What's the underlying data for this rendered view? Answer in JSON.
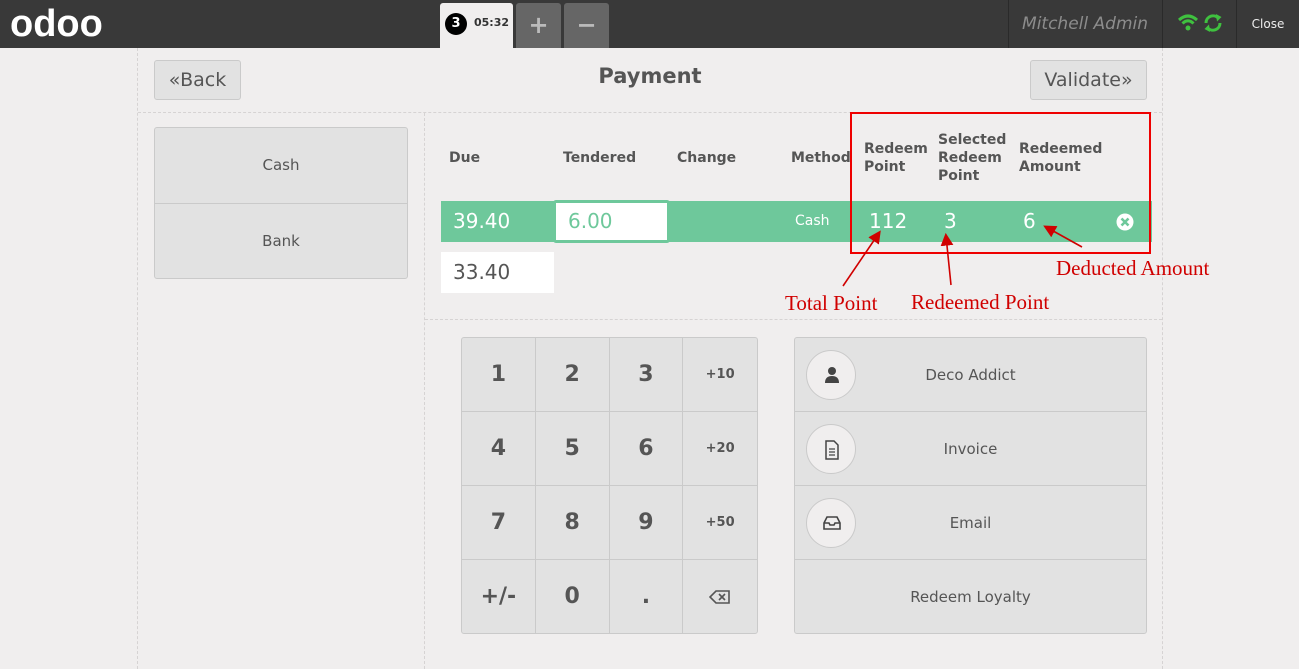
{
  "topbar": {
    "logo_text": "odoo",
    "order_number": "3",
    "order_time": "05:32",
    "add_order": "+",
    "remove_order": "−",
    "user_name": "Mitchell Admin",
    "close_label": "Close"
  },
  "payment": {
    "title": "Payment",
    "back_label": "Back",
    "validate_label": "Validate",
    "methods": [
      "Cash",
      "Bank"
    ],
    "columns": {
      "due": "Due",
      "tendered": "Tendered",
      "change": "Change",
      "method": "Method",
      "redeem_point": "Redeem Point",
      "selected_redeem_point": "Selected Redeem Point",
      "redeemed_amount": "Redeemed Amount"
    },
    "line": {
      "due": "39.40",
      "tendered": "6.00",
      "change": "",
      "method": "Cash",
      "redeem_point": "112",
      "selected_redeem_point": "3",
      "redeemed_amount": "6"
    },
    "remaining": "33.40"
  },
  "annotations": {
    "total_point": "Total Point",
    "redeemed_point": "Redeemed Point",
    "deducted_amount": "Deducted Amount",
    "color": "#d00000"
  },
  "numpad": {
    "keys": [
      "1",
      "2",
      "3",
      "+10",
      "4",
      "5",
      "6",
      "+20",
      "7",
      "8",
      "9",
      "+50",
      "+/-",
      "0",
      ".",
      "backspace-icon"
    ]
  },
  "actions": {
    "customer": "Deco Addict",
    "invoice": "Invoice",
    "email": "Email",
    "redeem_loyalty": "Redeem Loyalty"
  },
  "colors": {
    "topbar": "#393939",
    "accent_green": "#6ec89b",
    "background": "#f0eeee",
    "status_green": "#3fc13f"
  }
}
